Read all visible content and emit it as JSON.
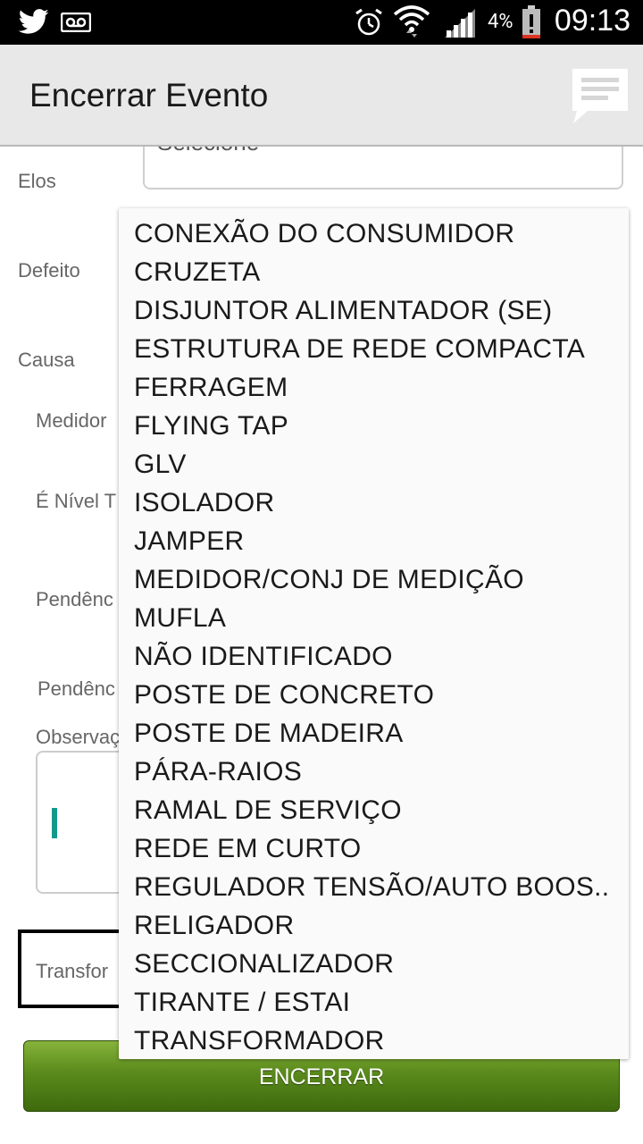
{
  "status_bar": {
    "time": "09:13",
    "battery_percent": "4%",
    "icons": [
      "twitter-icon",
      "voicemail-icon",
      "alarm-icon",
      "wifi-icon",
      "signal-icon",
      "battery-icon"
    ]
  },
  "app_bar": {
    "title": "Encerrar Evento",
    "chat_icon": "chat-icon"
  },
  "form": {
    "labels": {
      "elos": "Elos",
      "defeito": "Defeito",
      "causa": "Causa",
      "medidor": "Medidor",
      "nivel": "É Nível T",
      "pendencia1": "Pendênc",
      "pendencia2": "Pendênc",
      "observacao": "Observaç",
      "transformador": "Transfor"
    },
    "elos_select_value": "Selecione",
    "submit_label": "ENCERRAR"
  },
  "dropdown": {
    "options": [
      "CONEXÃO DO CONSUMIDOR",
      "CRUZETA",
      "DISJUNTOR ALIMENTADOR (SE)",
      "ESTRUTURA DE REDE COMPACTA",
      "FERRAGEM",
      "FLYING TAP",
      "GLV",
      "ISOLADOR",
      "JAMPER",
      "MEDIDOR/CONJ DE MEDIÇÃO",
      "MUFLA",
      "NÃO IDENTIFICADO",
      "POSTE DE CONCRETO",
      "POSTE DE MADEIRA",
      "PÁRA-RAIOS",
      "RAMAL DE SERVIÇO",
      "REDE EM CURTO",
      "REGULADOR TENSÃO/AUTO BOOS..",
      "RELIGADOR",
      "SECCIONALIZADOR",
      "TIRANTE / ESTAI",
      "TRANSFORMADOR"
    ]
  },
  "colors": {
    "status_bar_bg": "#000000",
    "app_bar_bg": "#e8e8e8",
    "button_green": "#5a8a1c",
    "cursor_teal": "#13998c"
  }
}
